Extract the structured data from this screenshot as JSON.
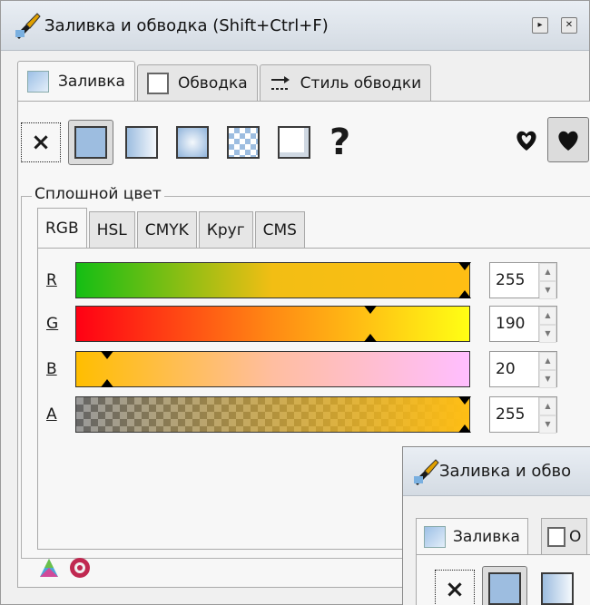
{
  "window": {
    "title": "Заливка и обводка (Shift+Ctrl+F)",
    "btn1": "▸",
    "btn2": "✕"
  },
  "tabs": [
    {
      "label": "Заливка"
    },
    {
      "label": "Обводка"
    },
    {
      "label": "Стиль обводки"
    }
  ],
  "paint_modes": {
    "none": "×",
    "unset": "?"
  },
  "section_label": "Сплошной цвет",
  "color_tabs": [
    "RGB",
    "HSL",
    "CMYK",
    "Круг",
    "CMS"
  ],
  "channels": [
    {
      "label": "R",
      "value": "255"
    },
    {
      "label": "G",
      "value": "190"
    },
    {
      "label": "B",
      "value": "20"
    },
    {
      "label": "A",
      "value": "255"
    }
  ],
  "channel_levels": [
    1.0,
    0.745,
    0.078,
    1.0
  ],
  "colors": {
    "accent_fill": "#ffbe14",
    "titlebar": "#d9e0e8"
  },
  "sub_window": {
    "title": "Заливка и обво",
    "tab1": "Заливка",
    "tab2": "О",
    "none": "×"
  }
}
